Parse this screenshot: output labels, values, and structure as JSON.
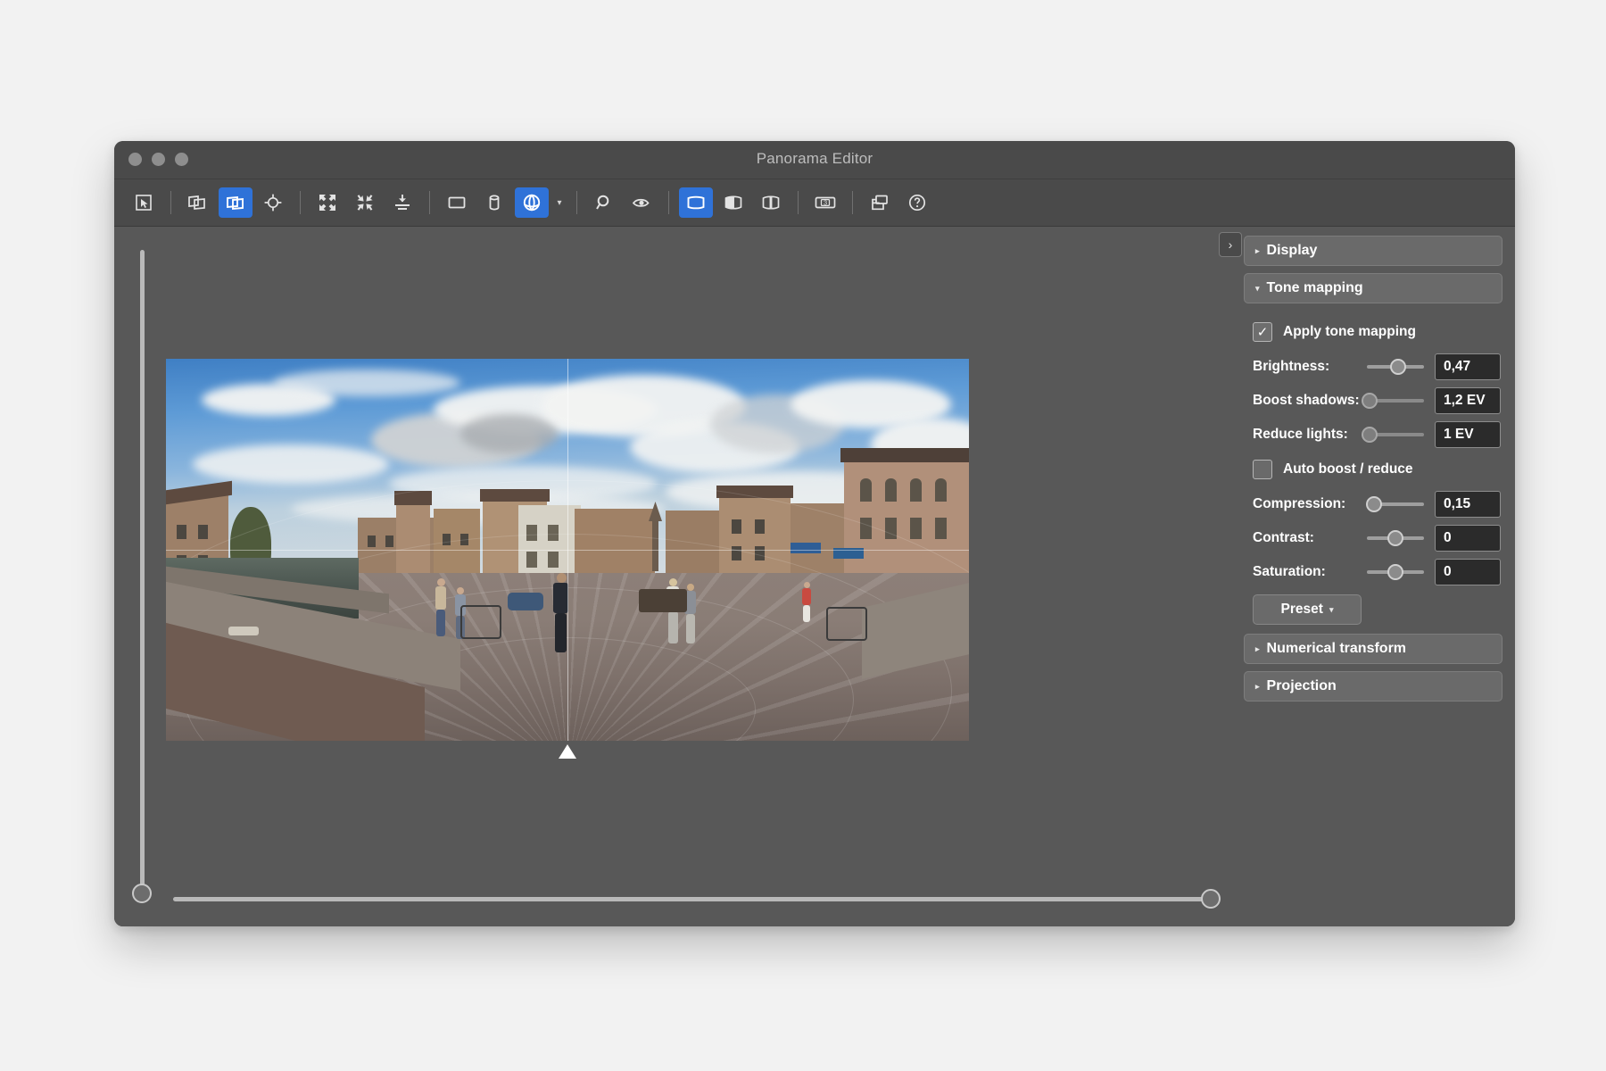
{
  "window": {
    "title": "Panorama Editor",
    "traffic_lights": [
      "close-button",
      "minimize-button",
      "zoom-button"
    ]
  },
  "toolbar": {
    "groups": [
      {
        "name": "selection",
        "items": [
          {
            "icon": "arrow-select-icon",
            "label": "Select",
            "selected": false
          }
        ]
      },
      {
        "name": "image-placement",
        "items": [
          {
            "icon": "move-images-icon",
            "label": "Move images",
            "selected": false
          },
          {
            "icon": "move-panorama-icon",
            "label": "Move panorama",
            "selected": true
          },
          {
            "icon": "set-center-icon",
            "label": "Set center point",
            "selected": false
          }
        ]
      },
      {
        "name": "fit",
        "items": [
          {
            "icon": "expand-fit-icon",
            "label": "Fit to window",
            "selected": false
          },
          {
            "icon": "contract-fit-icon",
            "label": "Shrink to content",
            "selected": false
          },
          {
            "icon": "vertical-fit-icon",
            "label": "Vertical fit",
            "selected": false
          }
        ]
      },
      {
        "name": "projection",
        "items": [
          {
            "icon": "planar-projection-icon",
            "label": "Planar projection",
            "selected": false
          },
          {
            "icon": "cylindrical-projection-icon",
            "label": "Cylindrical projection",
            "selected": false
          },
          {
            "icon": "spherical-projection-icon",
            "label": "Spherical projection",
            "selected": true
          },
          {
            "icon": "chevron-down-icon",
            "label": "More projections",
            "selected": false
          }
        ]
      },
      {
        "name": "view-tools",
        "items": [
          {
            "icon": "magnifier-icon",
            "label": "Zoom",
            "selected": false
          },
          {
            "icon": "eye-preview-icon",
            "label": "Preview",
            "selected": false
          }
        ]
      },
      {
        "name": "panorama-view-mode",
        "items": [
          {
            "icon": "panorama-full-icon",
            "label": "Full panorama",
            "selected": true
          },
          {
            "icon": "panorama-half-icon",
            "label": "Half panorama",
            "selected": false
          },
          {
            "icon": "panorama-split-icon",
            "label": "Split panorama",
            "selected": false
          }
        ]
      },
      {
        "name": "image-count",
        "items": [
          {
            "icon": "image-count-3-icon",
            "label": "3",
            "selected": false
          }
        ]
      },
      {
        "name": "utilities",
        "items": [
          {
            "icon": "layers-icon",
            "label": "Layers",
            "selected": false
          },
          {
            "icon": "help-circle-icon",
            "label": "Help",
            "selected": false
          }
        ]
      }
    ]
  },
  "canvas": {
    "vertical_slider": {
      "name": "vertical-pan-slider",
      "value_pct": 0
    },
    "horizontal_slider": {
      "name": "horizontal-pan-slider",
      "value_pct": 100
    },
    "center_marker": "center-point-marker",
    "image_alt": "Equirectangular 360 degree panorama of a canal-side square with historic brick gable houses, cobblestone pavement and pedestrians"
  },
  "panel": {
    "collapse_button": "›",
    "sections": [
      {
        "key": "display",
        "title": "Display",
        "expanded": false,
        "tri": "▸"
      },
      {
        "key": "tone_mapping",
        "title": "Tone mapping",
        "expanded": true,
        "tri": "▾"
      },
      {
        "key": "numerical_transform",
        "title": "Numerical transform",
        "expanded": false,
        "tri": "▸"
      },
      {
        "key": "projection",
        "title": "Projection",
        "expanded": false,
        "tri": "▸"
      }
    ],
    "tone_mapping": {
      "apply": {
        "label": "Apply tone mapping",
        "checked": true,
        "mark": "✓"
      },
      "brightness": {
        "label": "Brightness:",
        "value": "0,47",
        "slider_pct": 55,
        "enabled": true
      },
      "boost_shadows": {
        "label": "Boost shadows:",
        "value": "1,2 EV",
        "slider_pct": 5,
        "enabled": false
      },
      "reduce_lights": {
        "label": "Reduce lights:",
        "value": "1 EV",
        "slider_pct": 5,
        "enabled": false
      },
      "auto_boost": {
        "label": "Auto boost / reduce",
        "checked": false,
        "mark": "✓"
      },
      "compression": {
        "label": "Compression:",
        "value": "0,15",
        "slider_pct": 13,
        "enabled": true
      },
      "contrast": {
        "label": "Contrast:",
        "value": "0",
        "slider_pct": 50,
        "enabled": true
      },
      "saturation": {
        "label": "Saturation:",
        "value": "0",
        "slider_pct": 50,
        "enabled": true
      },
      "preset_button": {
        "label": "Preset",
        "caret": "▾"
      }
    }
  }
}
